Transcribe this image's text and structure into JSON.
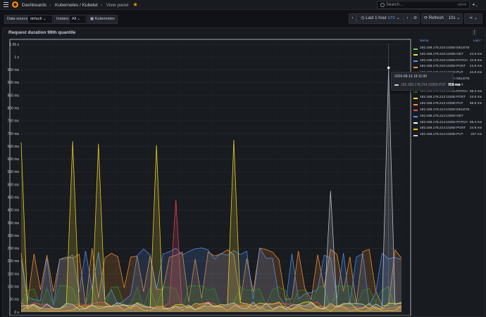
{
  "header": {
    "breadcrumbs": [
      "Dashboards",
      "Kubernetes / Kubelet",
      "View panel"
    ],
    "search_placeholder": "Search...",
    "search_shortcut": "ctrl+k",
    "plus_label": "+"
  },
  "toolbar": {
    "datasource_label": "Data source",
    "datasource_value": "default",
    "instance_label": "Instance",
    "instance_value": "All",
    "kubernetes_label": "Kubernetes",
    "time_range": "Last 1 hour",
    "timezone": "UTC",
    "refresh_label": "Refresh",
    "refresh_interval": "10s"
  },
  "panel": {
    "title": "Request duration 99th quantile",
    "legend_header_name": "Name",
    "legend_header_last": "Last *"
  },
  "legend": [
    {
      "name": "192.168.178.210:10250 DELETE",
      "last": "",
      "color": "#73bf69"
    },
    {
      "name": "192.168.178.210:10250 GET",
      "last": "24.9 ms",
      "color": "#fade2a"
    },
    {
      "name": "192.168.178.210:10250 PATCH",
      "last": "24.8 ms",
      "color": "#5794f2"
    },
    {
      "name": "192.168.178.210:10250 POST",
      "last": "24.8 ms",
      "color": "#ff9830"
    },
    {
      "name": "192.168.178.210:10250 PUT",
      "last": "24.8 ms",
      "color": "#f2495c"
    },
    {
      "name": "192.168.178.212:10250 DELETE",
      "last": "",
      "color": "#b877d9"
    },
    {
      "name": "192.168.178.212:10250 GET",
      "last": "",
      "color": "#705da0"
    },
    {
      "name": "192.168.178.212:10250 PATCH",
      "last": "99.3 ms",
      "color": "#37872d"
    },
    {
      "name": "192.168.178.212:10250 POST",
      "last": "24.8 ms",
      "color": "#fade2a"
    },
    {
      "name": "192.168.178.212:10250 PUT",
      "last": "96.8 ms",
      "color": "#ff9830"
    },
    {
      "name": "192.168.178.214:10250 DELETE",
      "last": "",
      "color": "#f2495c"
    },
    {
      "name": "192.168.178.214:10250 GET",
      "last": "",
      "color": "#5794f2"
    },
    {
      "name": "192.168.178.214:10250 PATCH",
      "last": "99.3 ms",
      "color": "#ffffff"
    },
    {
      "name": "192.168.178.214:10250 POST",
      "last": "24.8 ms",
      "color": "#f2cc0c"
    },
    {
      "name": "192.168.178.214:10250 PUT",
      "last": "237 ms",
      "color": "#c7d0d9"
    }
  ],
  "tooltip": {
    "time": "2026-08-16 18:11:00",
    "series": "192.168.178.214:10250 PUT",
    "value": "958 ms"
  },
  "chart_data": {
    "type": "area",
    "y_axis_labels": [
      "0 s",
      "50 ms",
      "100 ms",
      "150 ms",
      "200 ms",
      "250 ms",
      "300 ms",
      "350 ms",
      "400 ms",
      "450 ms",
      "500 ms",
      "550 ms",
      "600 ms",
      "650 ms",
      "700 ms",
      "750 ms",
      "800 ms",
      "850 ms",
      "900 ms",
      "950 ms",
      "1 s",
      "1.05 s"
    ],
    "ylim": [
      0,
      1050
    ],
    "unit": "ms",
    "points_per_series": 60,
    "series": [
      {
        "name": "192.168.178.210:10250 GET",
        "color": "#fade2a",
        "spikes": [
          [
            0,
            665
          ],
          [
            8,
            670
          ],
          [
            12,
            660
          ],
          [
            21,
            655
          ],
          [
            33,
            675
          ]
        ]
      },
      {
        "name": "192.168.178.214:10250 PUT",
        "color": "#c7d0d9",
        "spikes": [
          [
            57,
            958
          ],
          [
            48,
            475
          ]
        ]
      },
      {
        "name": "192.168.178.210:10250 PUT",
        "color": "#f2495c",
        "spikes": [
          [
            24,
            440
          ]
        ]
      },
      {
        "name": "192.168.178.212:10250 PUT",
        "color": "#ff9830",
        "base": 240
      },
      {
        "name": "192.168.178.210:10250 PATCH",
        "color": "#5794f2",
        "base": 240
      },
      {
        "name": "192.168.178.212:10250 PATCH",
        "color": "#37872d",
        "base": 100
      },
      {
        "name": "192.168.178.214:10250 POST",
        "color": "#f2cc0c",
        "base": 25
      }
    ]
  }
}
